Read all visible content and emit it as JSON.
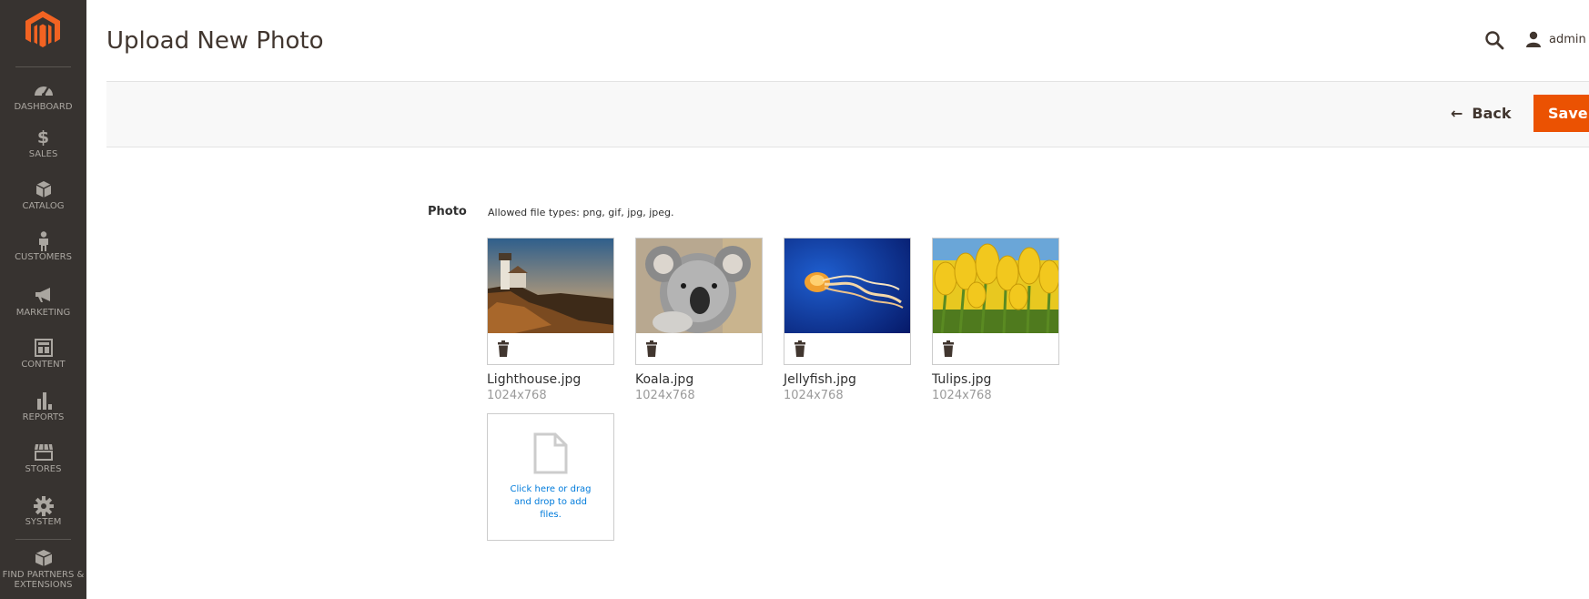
{
  "header": {
    "title": "Upload New Photo",
    "user": "admin"
  },
  "actions": {
    "back_label": "Back",
    "save_label": "Save"
  },
  "sidebar": {
    "items": [
      {
        "label": "DASHBOARD",
        "icon": "dashboard-icon"
      },
      {
        "label": "SALES",
        "icon": "dollar-icon"
      },
      {
        "label": "CATALOG",
        "icon": "box-icon"
      },
      {
        "label": "CUSTOMERS",
        "icon": "person-icon"
      },
      {
        "label": "MARKETING",
        "icon": "megaphone-icon"
      },
      {
        "label": "CONTENT",
        "icon": "layout-icon"
      },
      {
        "label": "REPORTS",
        "icon": "bar-chart-icon"
      },
      {
        "label": "STORES",
        "icon": "storefront-icon"
      },
      {
        "label": "SYSTEM",
        "icon": "gear-icon"
      },
      {
        "label": "FIND PARTNERS & EXTENSIONS",
        "icon": "partners-box-icon"
      }
    ]
  },
  "form": {
    "photo_label": "Photo",
    "allowed_note": "Allowed file types: png, gif, jpg, jpeg.",
    "files": [
      {
        "name": "Lighthouse.jpg",
        "size": "1024x768"
      },
      {
        "name": "Koala.jpg",
        "size": "1024x768"
      },
      {
        "name": "Jellyfish.jpg",
        "size": "1024x768"
      },
      {
        "name": "Tulips.jpg",
        "size": "1024x768"
      }
    ],
    "upload_text": "Click here or drag and drop to add files."
  },
  "colors": {
    "sidebar_bg": "#373330",
    "accent": "#eb5202",
    "link": "#007bdb"
  }
}
